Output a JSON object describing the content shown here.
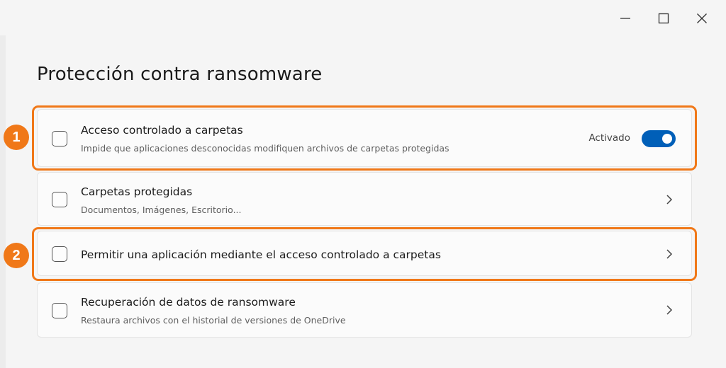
{
  "window": {
    "controls": [
      {
        "icon": "minimize-icon"
      },
      {
        "icon": "maximize-icon"
      },
      {
        "icon": "close-icon"
      }
    ]
  },
  "page": {
    "title": "Protección contra ransomware"
  },
  "items": [
    {
      "title": "Acceso controlado a carpetas",
      "subtitle": "Impide que aplicaciones desconocidas modifiquen archivos de carpetas protegidas",
      "status": "Activado",
      "toggle_on": true
    },
    {
      "title": "Carpetas protegidas",
      "subtitle": "Documentos, Imágenes, Escritorio..."
    },
    {
      "title": "Permitir una aplicación mediante el acceso controlado a carpetas"
    },
    {
      "title": "Recuperación de datos de ransomware",
      "subtitle": "Restaura archivos con el historial de versiones de OneDrive"
    }
  ],
  "annotations": [
    {
      "label": "1"
    },
    {
      "label": "2"
    }
  ],
  "colors": {
    "accent": "#005fb8",
    "annotation": "#f07818"
  }
}
